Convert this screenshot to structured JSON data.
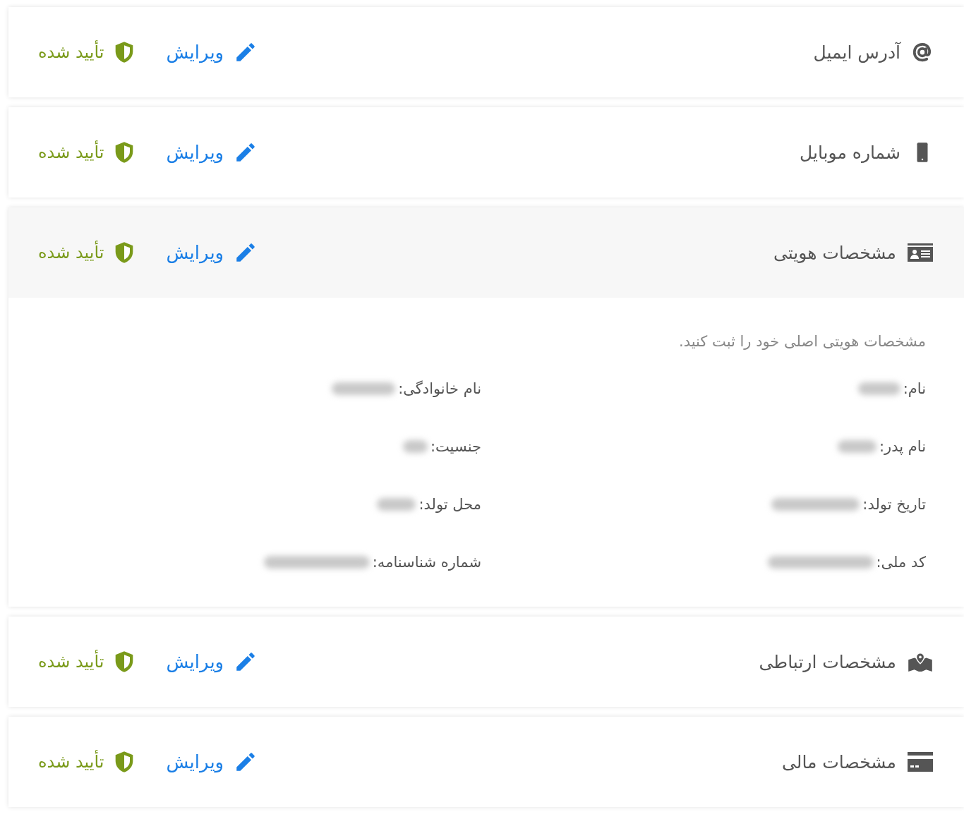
{
  "sections": [
    {
      "kind": "email",
      "title": "آدرس ایمیل",
      "edit_label": "ویرایش",
      "status": "تأیید شده",
      "verified": true,
      "expanded": false
    },
    {
      "kind": "mobile",
      "title": "شماره موبایل",
      "edit_label": "ویرایش",
      "status": "تأیید شده",
      "verified": true,
      "expanded": false
    },
    {
      "kind": "identity",
      "title": "مشخصات هویتی",
      "edit_label": "ویرایش",
      "status": "تأیید شده",
      "verified": true,
      "expanded": true,
      "details": {
        "intro": "مشخصات هویتی اصلی خود را ثبت کنید.",
        "fields": [
          {
            "label": "نام:",
            "blurred": true
          },
          {
            "label": "نام خانوادگی:",
            "blurred": true
          },
          {
            "label": "نام پدر:",
            "blurred": true
          },
          {
            "label": "جنسیت:",
            "blurred": true
          },
          {
            "label": "تاریخ تولد:",
            "blurred": true
          },
          {
            "label": "محل تولد:",
            "blurred": true
          },
          {
            "label": "کد ملی:",
            "blurred": true
          },
          {
            "label": "شماره شناسنامه:",
            "blurred": true
          }
        ]
      }
    },
    {
      "kind": "contact",
      "title": "مشخصات ارتباطی",
      "edit_label": "ویرایش",
      "status": "تأیید شده",
      "verified": true,
      "expanded": false
    },
    {
      "kind": "financial",
      "title": "مشخصات مالی",
      "edit_label": "ویرایش",
      "status": "تأیید شده",
      "verified": true,
      "expanded": false
    }
  ]
}
